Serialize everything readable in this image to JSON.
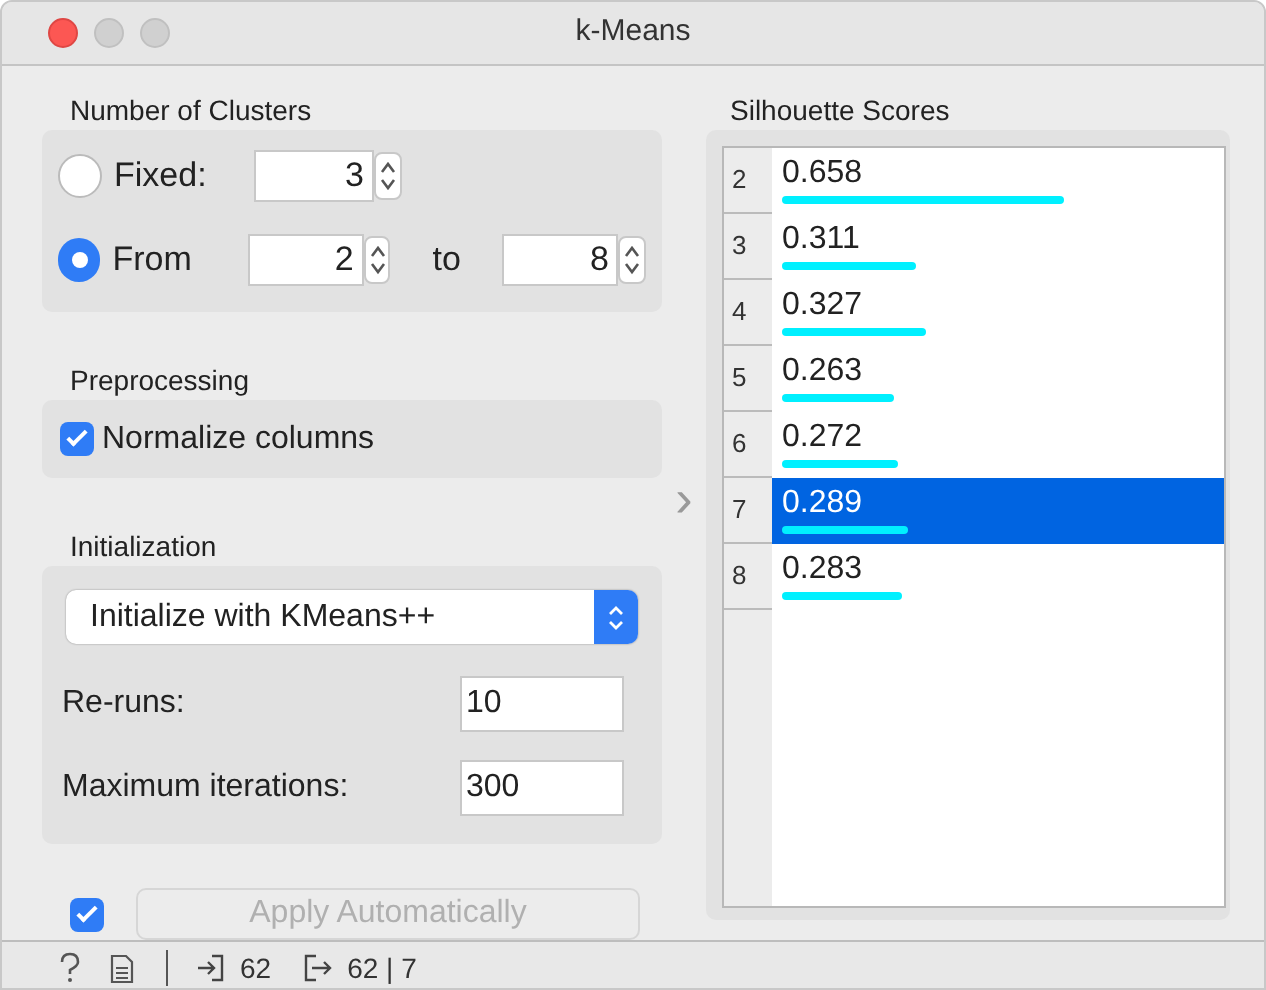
{
  "window": {
    "title": "k-Means"
  },
  "number_of_clusters": {
    "title": "Number of Clusters",
    "options": [
      {
        "label": "Fixed:",
        "selected": false,
        "value": "3"
      },
      {
        "label": "From",
        "selected": true,
        "value": "2",
        "to_label": "to",
        "to_value": "8"
      }
    ]
  },
  "preprocessing": {
    "title": "Preprocessing",
    "normalize": {
      "label": "Normalize columns",
      "checked": true
    }
  },
  "initialization": {
    "title": "Initialization",
    "method": "Initialize with KMeans++",
    "fields": [
      {
        "label": "Re-runs:",
        "value": "10"
      },
      {
        "label": "Maximum iterations:",
        "value": "300"
      }
    ]
  },
  "apply": {
    "checked": true,
    "label": "Apply Automatically",
    "disabled": true
  },
  "expand_arrow": "›",
  "silhouette": {
    "title": "Silhouette Scores",
    "rows": [
      {
        "k": "2",
        "score": "0.658",
        "level": 0.63,
        "selected": false
      },
      {
        "k": "3",
        "score": "0.311",
        "level": 0.3,
        "selected": false
      },
      {
        "k": "4",
        "score": "0.327",
        "level": 0.32,
        "selected": false
      },
      {
        "k": "5",
        "score": "0.263",
        "level": 0.25,
        "selected": false
      },
      {
        "k": "6",
        "score": "0.272",
        "level": 0.26,
        "selected": false
      },
      {
        "k": "7",
        "score": "0.289",
        "level": 0.28,
        "selected": true
      },
      {
        "k": "8",
        "score": "0.283",
        "level": 0.27,
        "selected": false
      }
    ]
  },
  "status_bar": {
    "input": "62",
    "output": "62 | 7"
  }
}
